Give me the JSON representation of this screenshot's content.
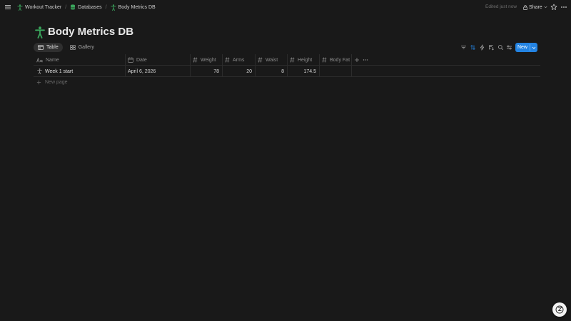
{
  "breadcrumbs": [
    {
      "label": "Workout Tracker",
      "icon": "person-icon"
    },
    {
      "label": "Databases",
      "icon": "database-icon"
    },
    {
      "label": "Body Metrics DB",
      "icon": "person-icon"
    }
  ],
  "breadcrumb_separator": "/",
  "header": {
    "edited": "Edited just now",
    "share_label": "Share"
  },
  "page": {
    "title": "Body Metrics DB",
    "icon": "accessibility-person-icon",
    "accent_color": "#3aa65c"
  },
  "views": [
    {
      "label": "Table",
      "icon": "table-icon",
      "active": true
    },
    {
      "label": "Gallery",
      "icon": "gallery-icon",
      "active": false
    }
  ],
  "toolbar": {
    "new_label": "New",
    "new_button_color": "#2383e2",
    "icons": [
      "filter-icon",
      "sort-icon",
      "automation-icon",
      "calendar-sort-icon",
      "search-icon",
      "settings-icon"
    ]
  },
  "table": {
    "columns": [
      {
        "label": "Name",
        "icon": "text-type-icon"
      },
      {
        "label": "Date",
        "icon": "calendar-icon"
      },
      {
        "label": "Weight",
        "icon": "number-icon"
      },
      {
        "label": "Arms",
        "icon": "number-icon"
      },
      {
        "label": "Waist",
        "icon": "number-icon"
      },
      {
        "label": "Height",
        "icon": "number-icon"
      },
      {
        "label": "Body Fat",
        "icon": "number-icon"
      }
    ],
    "rows": [
      {
        "name": "Week 1 start",
        "date": "April 6, 2026",
        "weight": "78",
        "arms": "20",
        "waist": "8",
        "height": "174.5",
        "body_fat": ""
      }
    ],
    "new_page_label": "New page"
  }
}
